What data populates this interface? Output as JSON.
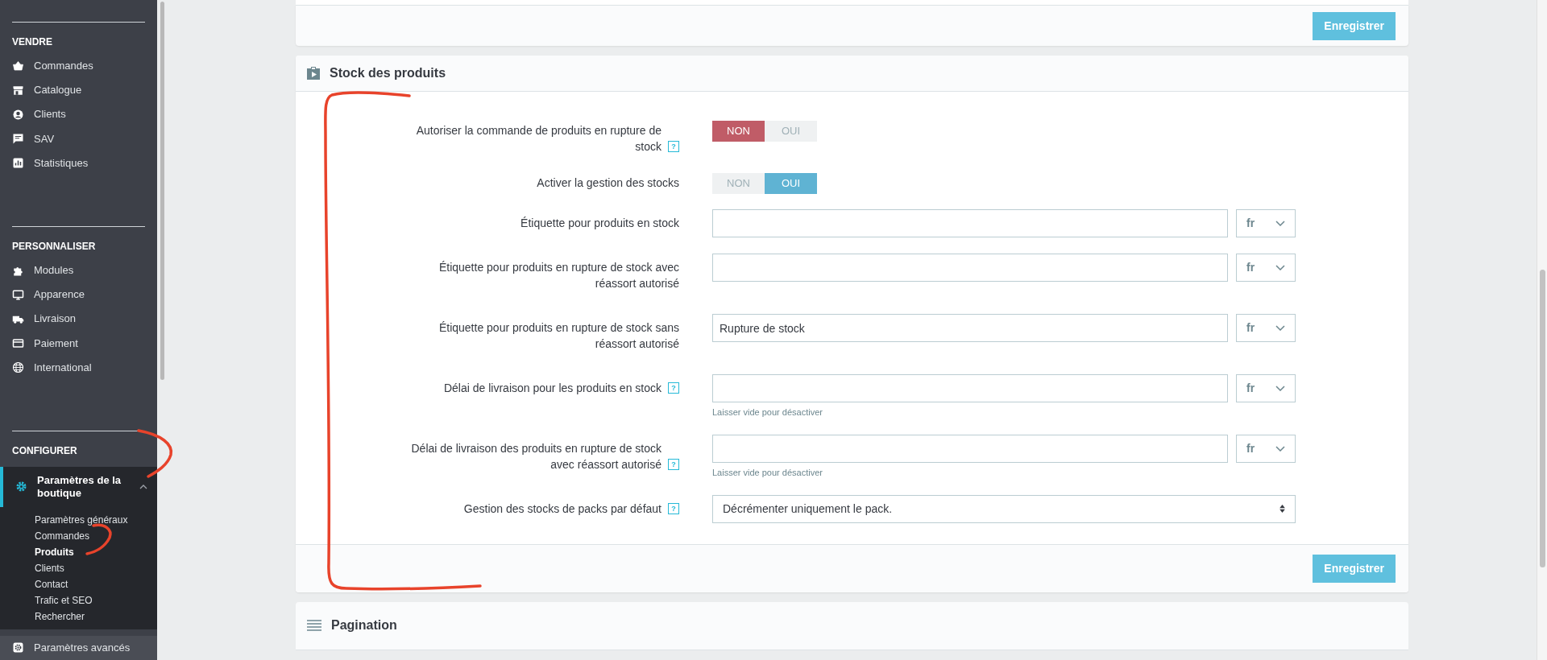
{
  "sidebar": {
    "sections": [
      {
        "title": "VENDRE",
        "items": [
          {
            "label": "Commandes",
            "selected": false
          },
          {
            "label": "Catalogue",
            "selected": false
          },
          {
            "label": "Clients",
            "selected": false
          },
          {
            "label": "SAV",
            "selected": false
          },
          {
            "label": "Statistiques",
            "selected": false
          }
        ]
      },
      {
        "title": "PERSONNALISER",
        "items": [
          {
            "label": "Modules",
            "selected": false
          },
          {
            "label": "Apparence",
            "selected": false
          },
          {
            "label": "Livraison",
            "selected": false
          },
          {
            "label": "Paiement",
            "selected": false
          },
          {
            "label": "International",
            "selected": false
          }
        ]
      },
      {
        "title": "CONFIGURER",
        "items": [
          {
            "label": "Paramètres de la boutique",
            "selected": true,
            "expanded": true,
            "children": [
              {
                "label": "Paramètres généraux",
                "selected": false
              },
              {
                "label": "Commandes",
                "selected": false
              },
              {
                "label": "Produits",
                "selected": true
              },
              {
                "label": "Clients",
                "selected": false
              },
              {
                "label": "Contact",
                "selected": false
              },
              {
                "label": "Trafic et SEO",
                "selected": false
              },
              {
                "label": "Rechercher",
                "selected": false
              }
            ]
          },
          {
            "label": "Paramètres avancés",
            "selected": false,
            "expanded": false
          }
        ]
      }
    ]
  },
  "top_panel": {
    "button": "Enregistrer"
  },
  "panel": {
    "title": "Stock des produits",
    "fields": [
      {
        "kind": "toggle",
        "label": "Autoriser la commande de produits en rupture de stock",
        "help": "?",
        "options": [
          {
            "label": "NON",
            "selected": true
          },
          {
            "label": "OUI",
            "selected": false
          }
        ]
      },
      {
        "kind": "toggle",
        "label": "Activer la gestion des stocks",
        "options": [
          {
            "label": "NON",
            "selected": false
          },
          {
            "label": "OUI",
            "selected": true
          }
        ]
      },
      {
        "kind": "text",
        "label": "Étiquette pour produits en stock",
        "lang": "fr"
      },
      {
        "kind": "text",
        "label": "Étiquette pour produits en rupture de stock avec réassort autorisé",
        "lang": "fr"
      },
      {
        "kind": "text",
        "label": "Étiquette pour produits en rupture de stock sans réassort autorisé",
        "lang": "fr",
        "value": "Rupture de stock"
      },
      {
        "kind": "text",
        "label": "Délai de livraison pour les produits en stock",
        "help": "?",
        "lang": "fr",
        "hint": "Laisser vide pour désactiver"
      },
      {
        "kind": "text",
        "label": "Délai de livraison des produits en rupture de stock avec réassort autorisé",
        "help": "?",
        "lang": "fr",
        "hint": "Laisser vide pour désactiver"
      },
      {
        "kind": "select",
        "label": "Gestion des stocks de packs par défaut",
        "help": "?",
        "value": "Décrémenter uniquement le pack."
      }
    ],
    "button": "Enregistrer"
  },
  "pagination_panel": {
    "title": "Pagination"
  },
  "annotation_marks": [
    {
      "kind": "bracket"
    },
    {
      "kind": "arc"
    },
    {
      "kind": "hook"
    }
  ]
}
